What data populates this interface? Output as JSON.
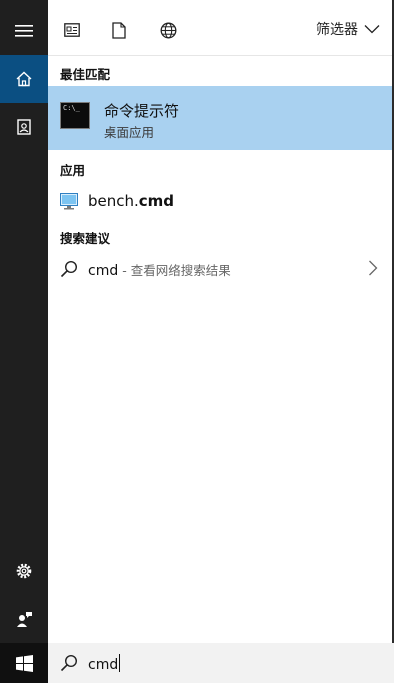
{
  "toolbar": {
    "icons": [
      "document-list-icon",
      "file-icon",
      "globe-icon"
    ],
    "filter_label": "筛选器"
  },
  "best_match": {
    "header": "最佳匹配",
    "title": "命令提示符",
    "subtitle": "桌面应用",
    "icon_text": "C:\\_"
  },
  "apps": {
    "header": "应用",
    "item_prefix": "bench.",
    "item_bold": "cmd"
  },
  "suggestions": {
    "header": "搜索建议",
    "query": "cmd",
    "hint": " - 查看网络搜索结果"
  },
  "search": {
    "value": "cmd"
  },
  "colors": {
    "selected": "#a9d1f0",
    "rail": "#1f1f1f",
    "home_active": "#0b4f82"
  }
}
